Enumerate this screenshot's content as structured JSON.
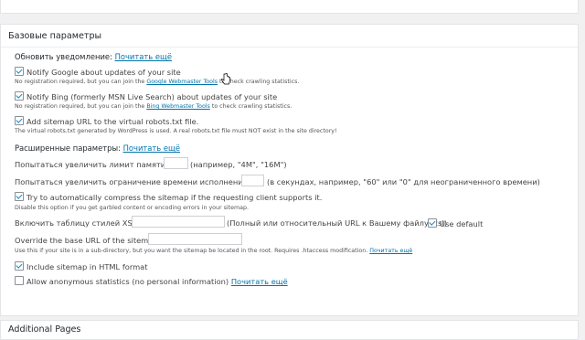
{
  "panel": {
    "title": "Базовые параметры"
  },
  "notify": {
    "heading": "Обновить уведомление:",
    "read_more": "Почитать ещё",
    "google": {
      "label": "Notify Google about updates of your site",
      "note_pre": "No registration required, but you can join the",
      "note_link": "Google Webmaster Tools",
      "note_post": "to check crawling statistics."
    },
    "bing": {
      "label": "Notify Bing (formerly MSN Live Search) about updates of your site",
      "note_pre": "No registration required, but you can join the",
      "note_link": "Bing Webmaster Tools",
      "note_post": "to check crawling statistics."
    },
    "robots": {
      "label": "Add sitemap URL to the virtual robots.txt file.",
      "note": "The virtual robots.txt generated by WordPress is used. A real robots.txt file must NOT exist in the site directory!"
    }
  },
  "advanced": {
    "heading": "Расширенные параметры:",
    "read_more": "Почитать ещё",
    "memory": {
      "label": "Попытаться увеличить лимит памяти до:",
      "value": "",
      "hint": "(например, \"4M\", \"16M\")"
    },
    "time": {
      "label": "Попытаться увеличить ограничение времени исполнения до:",
      "value": "",
      "hint": "(в секундах, например, \"60\" или \"0\" для неограниченного времени)"
    },
    "compress": {
      "label": "Try to automatically compress the sitemap if the requesting client supports it.",
      "note": "Disable this option if you get garbled content or encoding errors in your sitemap."
    },
    "xslt": {
      "label": "Включить таблицу стилей XSLT:",
      "value": "",
      "hint": "(Полный или относительный URL к Вашему файлу .xsl)",
      "default_label": "Use default"
    },
    "base_url": {
      "label": "Override the base URL of the sitemap:",
      "value": "",
      "note": "Use this if your site is in a sub-directory, but you want the sitemap be located in the root. Requires .htaccess modification.",
      "read_more": "Почитать ещё"
    },
    "html_format": {
      "label": "Include sitemap in HTML format"
    },
    "anon_stats": {
      "label": "Allow anonymous statistics (no personal information)",
      "read_more": "Почитать ещё"
    }
  },
  "states": {
    "google_checked": true,
    "bing_checked": true,
    "robots_checked": true,
    "compress_checked": true,
    "use_default_checked": true,
    "html_format_checked": true,
    "anon_stats_checked": false
  },
  "next_panel": {
    "title": "Additional Pages"
  }
}
